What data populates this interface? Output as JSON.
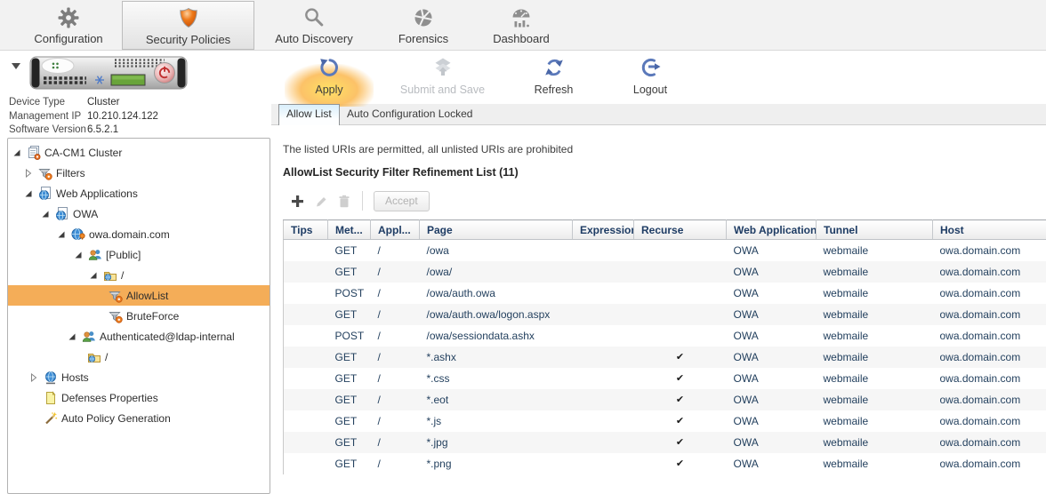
{
  "nav": {
    "items": [
      {
        "label": "Configuration"
      },
      {
        "label": "Security Policies"
      },
      {
        "label": "Auto Discovery"
      },
      {
        "label": "Forensics"
      },
      {
        "label": "Dashboard"
      }
    ]
  },
  "actions": {
    "apply": "Apply",
    "submit": "Submit and Save",
    "refresh": "Refresh",
    "logout": "Logout"
  },
  "tabs": {
    "active": "Allow List",
    "locked": "Auto Configuration Locked"
  },
  "device": {
    "fields": [
      {
        "label": "Device Type",
        "value": "Cluster"
      },
      {
        "label": "Management IP",
        "value": "10.210.124.122"
      },
      {
        "label": "Software Version",
        "value": "6.5.2.1"
      }
    ]
  },
  "tree": {
    "items": [
      {
        "label": "CA-CM1 Cluster"
      },
      {
        "label": "Filters"
      },
      {
        "label": "Web Applications"
      },
      {
        "label": "OWA"
      },
      {
        "label": "owa.domain.com"
      },
      {
        "label": "[Public]"
      },
      {
        "label": "/"
      },
      {
        "label": "AllowList"
      },
      {
        "label": "BruteForce"
      },
      {
        "label": "Authenticated@ldap-internal"
      },
      {
        "label": "/"
      },
      {
        "label": "Hosts"
      },
      {
        "label": "Defenses Properties"
      },
      {
        "label": "Auto Policy Generation"
      }
    ]
  },
  "content": {
    "info": "The listed URIs are permitted, all unlisted URIs are prohibited",
    "title": "AllowList Security Filter Refinement List (11)",
    "accept": "Accept",
    "table": {
      "columns": [
        "Tips",
        "Met...",
        "Appl...",
        "Page",
        "Expression",
        "Recurse",
        "Web Application",
        "Tunnel",
        "Host"
      ],
      "rows": [
        {
          "tips": "",
          "method": "GET",
          "appl": "/",
          "page": "/owa",
          "expression": "",
          "recurse": false,
          "web_application": "OWA",
          "tunnel": "webmaile",
          "host": "owa.domain.com"
        },
        {
          "tips": "",
          "method": "GET",
          "appl": "/",
          "page": "/owa/",
          "expression": "",
          "recurse": false,
          "web_application": "OWA",
          "tunnel": "webmaile",
          "host": "owa.domain.com"
        },
        {
          "tips": "",
          "method": "POST",
          "appl": "/",
          "page": "/owa/auth.owa",
          "expression": "",
          "recurse": false,
          "web_application": "OWA",
          "tunnel": "webmaile",
          "host": "owa.domain.com"
        },
        {
          "tips": "",
          "method": "GET",
          "appl": "/",
          "page": "/owa/auth.owa/logon.aspx",
          "expression": "",
          "recurse": false,
          "web_application": "OWA",
          "tunnel": "webmaile",
          "host": "owa.domain.com"
        },
        {
          "tips": "",
          "method": "POST",
          "appl": "/",
          "page": "/owa/sessiondata.ashx",
          "expression": "",
          "recurse": false,
          "web_application": "OWA",
          "tunnel": "webmaile",
          "host": "owa.domain.com"
        },
        {
          "tips": "",
          "method": "GET",
          "appl": "/",
          "page": "*.ashx",
          "expression": "",
          "recurse": true,
          "web_application": "OWA",
          "tunnel": "webmaile",
          "host": "owa.domain.com"
        },
        {
          "tips": "",
          "method": "GET",
          "appl": "/",
          "page": "*.css",
          "expression": "",
          "recurse": true,
          "web_application": "OWA",
          "tunnel": "webmaile",
          "host": "owa.domain.com"
        },
        {
          "tips": "",
          "method": "GET",
          "appl": "/",
          "page": "*.eot",
          "expression": "",
          "recurse": true,
          "web_application": "OWA",
          "tunnel": "webmaile",
          "host": "owa.domain.com"
        },
        {
          "tips": "",
          "method": "GET",
          "appl": "/",
          "page": "*.js",
          "expression": "",
          "recurse": true,
          "web_application": "OWA",
          "tunnel": "webmaile",
          "host": "owa.domain.com"
        },
        {
          "tips": "",
          "method": "GET",
          "appl": "/",
          "page": "*.jpg",
          "expression": "",
          "recurse": true,
          "web_application": "OWA",
          "tunnel": "webmaile",
          "host": "owa.domain.com"
        },
        {
          "tips": "",
          "method": "GET",
          "appl": "/",
          "page": "*.png",
          "expression": "",
          "recurse": true,
          "web_application": "OWA",
          "tunnel": "webmaile",
          "host": "owa.domain.com"
        }
      ]
    }
  },
  "colors": {
    "selection_orange": "#f4ad58",
    "icon_blue": "#5b79ba",
    "shield_orange": "#e8650f",
    "apply_glow": "#ffc83d"
  }
}
